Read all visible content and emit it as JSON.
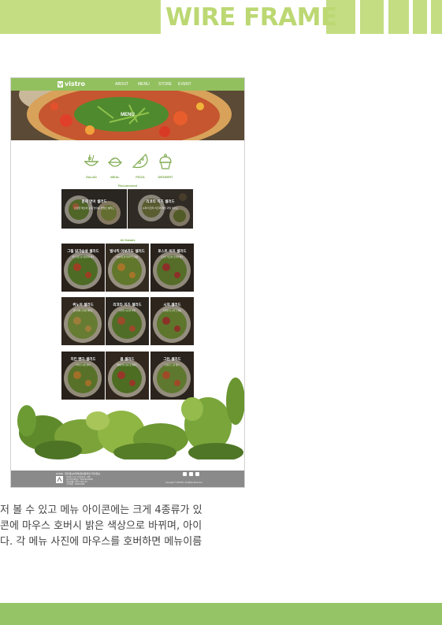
{
  "header": {
    "title": "WIRE FRAME"
  },
  "mockup": {
    "logo": "vistro",
    "nav": [
      "ABOUT",
      "MENU",
      "STORE",
      "EVENT"
    ],
    "hero_title": "MENU",
    "categories": [
      {
        "label": "SALAD",
        "icon": "salad-bowl-icon"
      },
      {
        "label": "MEAL",
        "icon": "rice-bowl-icon"
      },
      {
        "label": "PIZZA",
        "icon": "pizza-slice-icon"
      },
      {
        "label": "DESSERT",
        "icon": "cupcake-icon"
      }
    ],
    "recommend_title": "Recommend",
    "recommend": [
      {
        "title": "훈제 연어 샐러드",
        "desc": "신선한 채소와 훈제 연어를 곁들인 샐러드"
      },
      {
        "title": "리코타 치즈 샐러드",
        "desc": "수제 리코타 치즈와 제철 과일 샐러드"
      }
    ],
    "all_title": "All Salads",
    "salads": [
      {
        "title": "그릴 닭가슴살 샐러드",
        "desc": "부드러운 닭가슴살과 채소"
      },
      {
        "title": "발사믹 아보카도 샐러드",
        "desc": "아보카도와 발사믹 드레싱"
      },
      {
        "title": "로스트 비프 샐러드",
        "desc": "로스트 비프와 신선한 채소"
      },
      {
        "title": "퀴노아 샐러드",
        "desc": "퀴노아와 견과류 샐러드"
      },
      {
        "title": "리코타 치즈 샐러드",
        "desc": "리코타 치즈와 과일"
      },
      {
        "title": "시저 샐러드",
        "desc": "로메인과 시저 드레싱"
      },
      {
        "title": "치킨 텐더 샐러드",
        "desc": "바삭한 치킨 텐더"
      },
      {
        "title": "콥 샐러드",
        "desc": "베이컨과 달걀 콥 샐러드"
      },
      {
        "title": "그린 샐러드",
        "desc": "신선한 그린 채소"
      }
    ],
    "footer": {
      "links": [
        "HOME",
        "개인정보처리방침",
        "이용약관",
        "위치정보"
      ],
      "info": [
        "(주)비스트로  |  대표이사 : 000",
        "사업자등록번호 : 000-00-00000",
        "서울특별시 00구 00로 00",
        "고객센터 : 0000-0000"
      ],
      "copyright": "Copyright © VISTRO. All Rights Reserved."
    }
  },
  "description": [
    "저 볼 수 있고 메뉴 아이콘에는 크게 4종류가 있",
    "콘에 마우스 호버시 밝은 색상으로 바뀌며, 아이",
    "다. 각 메뉴 사진에 마우스를 호버하면 메뉴이름"
  ],
  "colors": {
    "accent_light": "#c4dd82",
    "accent": "#92c05f",
    "band": "#95c467"
  }
}
